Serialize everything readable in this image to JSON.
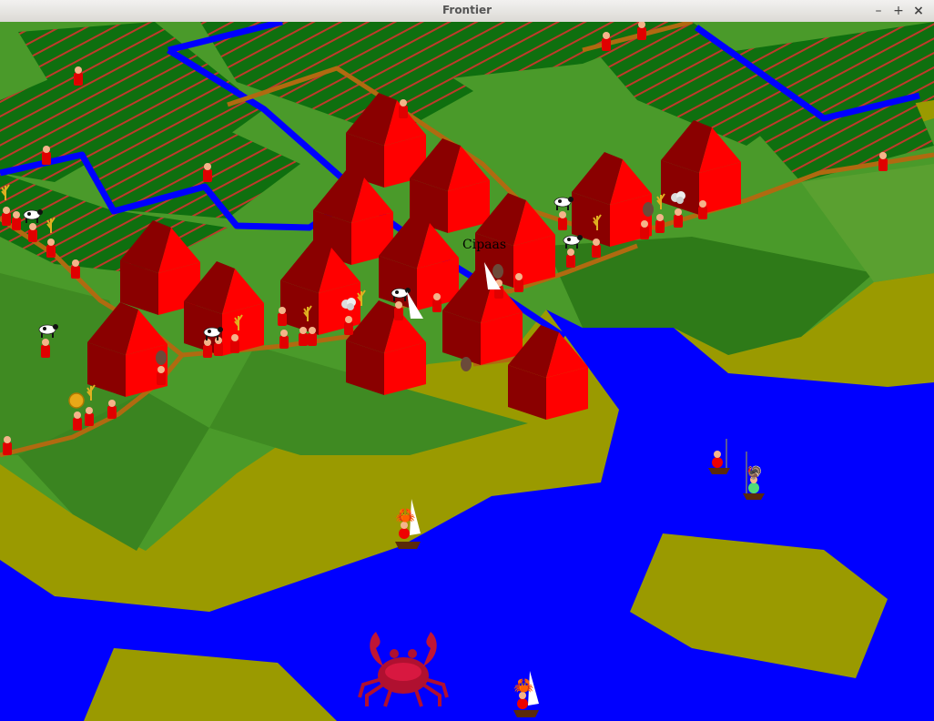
{
  "window": {
    "title": "Frontier",
    "controls": {
      "minimize": "–",
      "maximize": "+",
      "close": "×"
    }
  },
  "map": {
    "settlement_label": "Cipaas",
    "colors": {
      "water": "#0000ff",
      "grass_light": "#4a9a2a",
      "grass_dark": "#2f7a18",
      "sand": "#9a9a00",
      "field": "#0f6f0f",
      "crop_row": "#c0392b",
      "road": "#b06a10",
      "house_roof": "#cc0000",
      "house_wall": "#ff0000",
      "house_shade": "#8a0000"
    },
    "icons": [
      "house-icon",
      "villager-icon",
      "cow-icon",
      "wheat-icon",
      "crab-icon",
      "sailboat-icon",
      "fishing-boat-icon",
      "coin-icon",
      "wool-icon",
      "bull-icon"
    ]
  }
}
